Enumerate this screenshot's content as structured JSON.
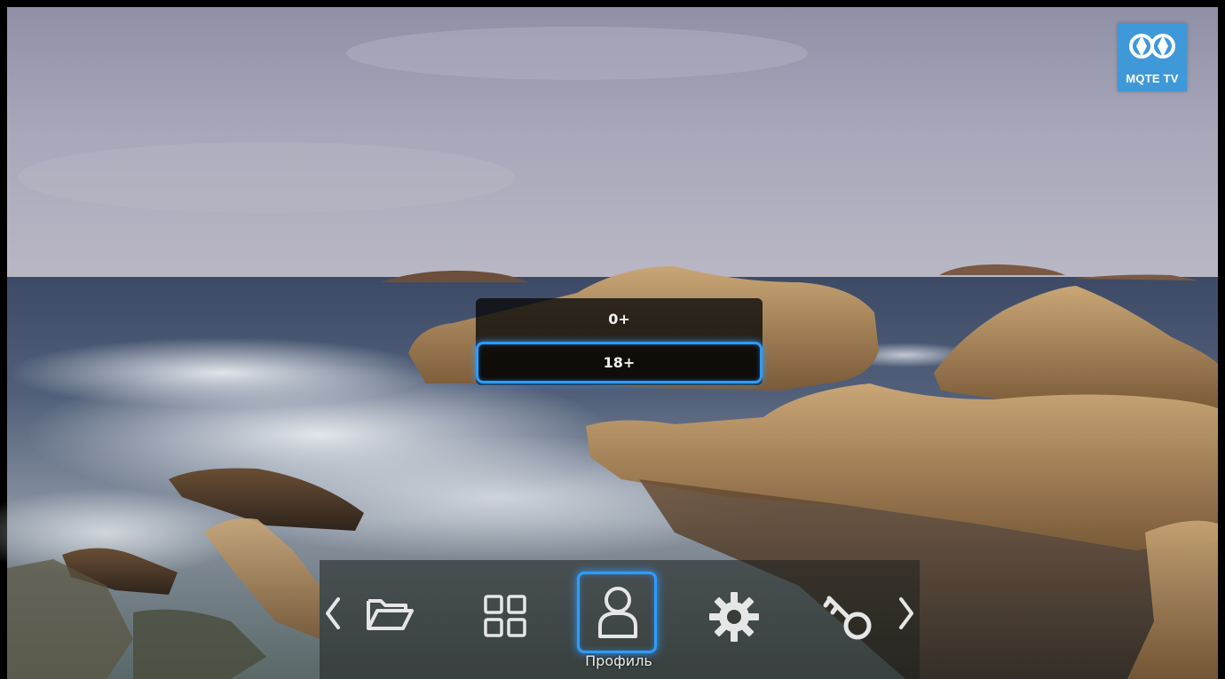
{
  "branding": {
    "logo_text": "MQTE TV"
  },
  "age_menu": {
    "options": [
      {
        "label": "0+",
        "selected": false
      },
      {
        "label": "18+",
        "selected": true
      }
    ]
  },
  "nav_bar": {
    "items": [
      {
        "name": "prev",
        "icon": "chevron-left-icon"
      },
      {
        "name": "files",
        "icon": "folder-open-icon"
      },
      {
        "name": "apps",
        "icon": "grid-icon"
      },
      {
        "name": "profile",
        "icon": "user-icon",
        "focused": true
      },
      {
        "name": "settings",
        "icon": "gear-icon"
      },
      {
        "name": "key",
        "icon": "key-icon"
      },
      {
        "name": "next",
        "icon": "chevron-right-icon"
      }
    ],
    "focused_label": "Профиль"
  },
  "colors": {
    "focus_accent": "#2e9cff",
    "logo_bg": "#3f98d8"
  }
}
